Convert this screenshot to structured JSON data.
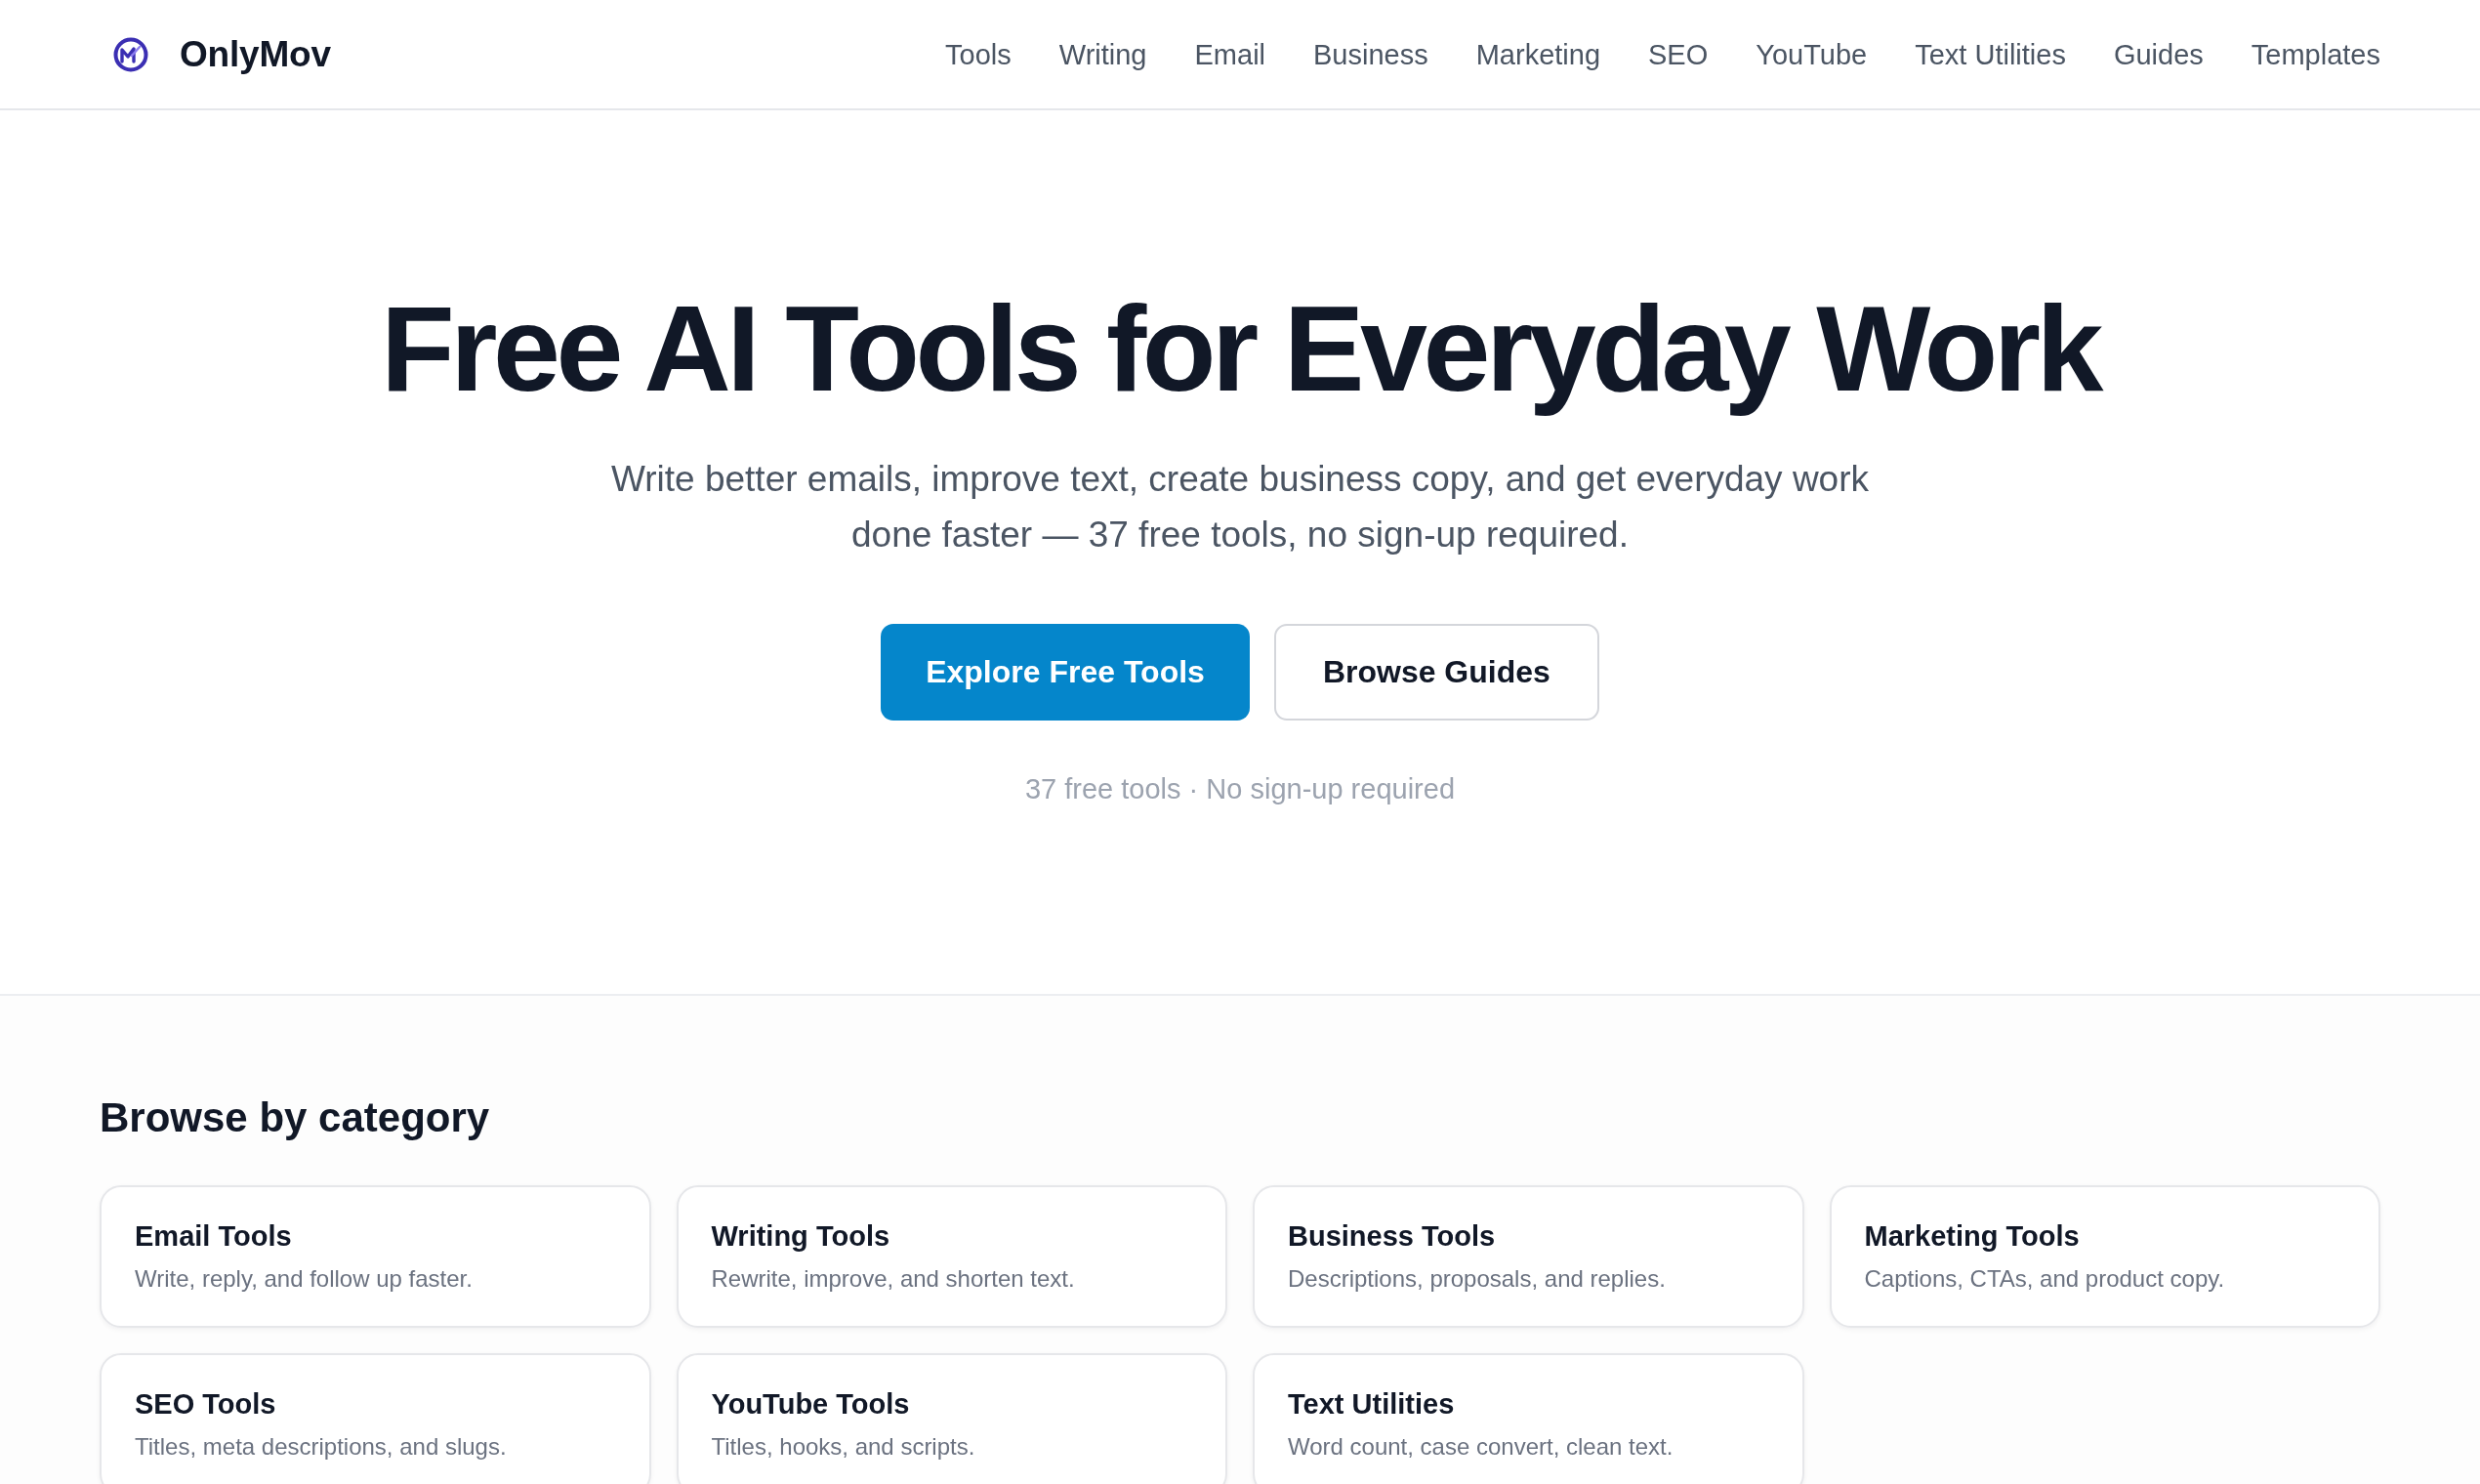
{
  "header": {
    "brand": "OnlyMov",
    "nav": [
      "Tools",
      "Writing",
      "Email",
      "Business",
      "Marketing",
      "SEO",
      "YouTube",
      "Text Utilities",
      "Guides",
      "Templates"
    ]
  },
  "hero": {
    "title": "Free AI Tools for Everyday Work",
    "subtitle": "Write better emails, improve text, create business copy, and get everyday work done faster — 37 free tools, no sign-up required.",
    "buttons": [
      {
        "label": "Explore Free Tools",
        "kind": "primary"
      },
      {
        "label": "Browse Guides",
        "kind": "secondary"
      }
    ],
    "note": "37 free tools · No sign-up required"
  },
  "categories": {
    "heading": "Browse by category",
    "cards": [
      {
        "title": "Email Tools",
        "description": "Write, reply, and follow up faster."
      },
      {
        "title": "Writing Tools",
        "description": "Rewrite, improve, and shorten text."
      },
      {
        "title": "Business Tools",
        "description": "Descriptions, proposals, and replies."
      },
      {
        "title": "Marketing Tools",
        "description": "Captions, CTAs, and product copy."
      },
      {
        "title": "SEO Tools",
        "description": "Titles, meta descriptions, and slugs."
      },
      {
        "title": "YouTube Tools",
        "description": "Titles, hooks, and scripts."
      },
      {
        "title": "Text Utilities",
        "description": "Word count, case convert, clean text."
      }
    ]
  }
}
